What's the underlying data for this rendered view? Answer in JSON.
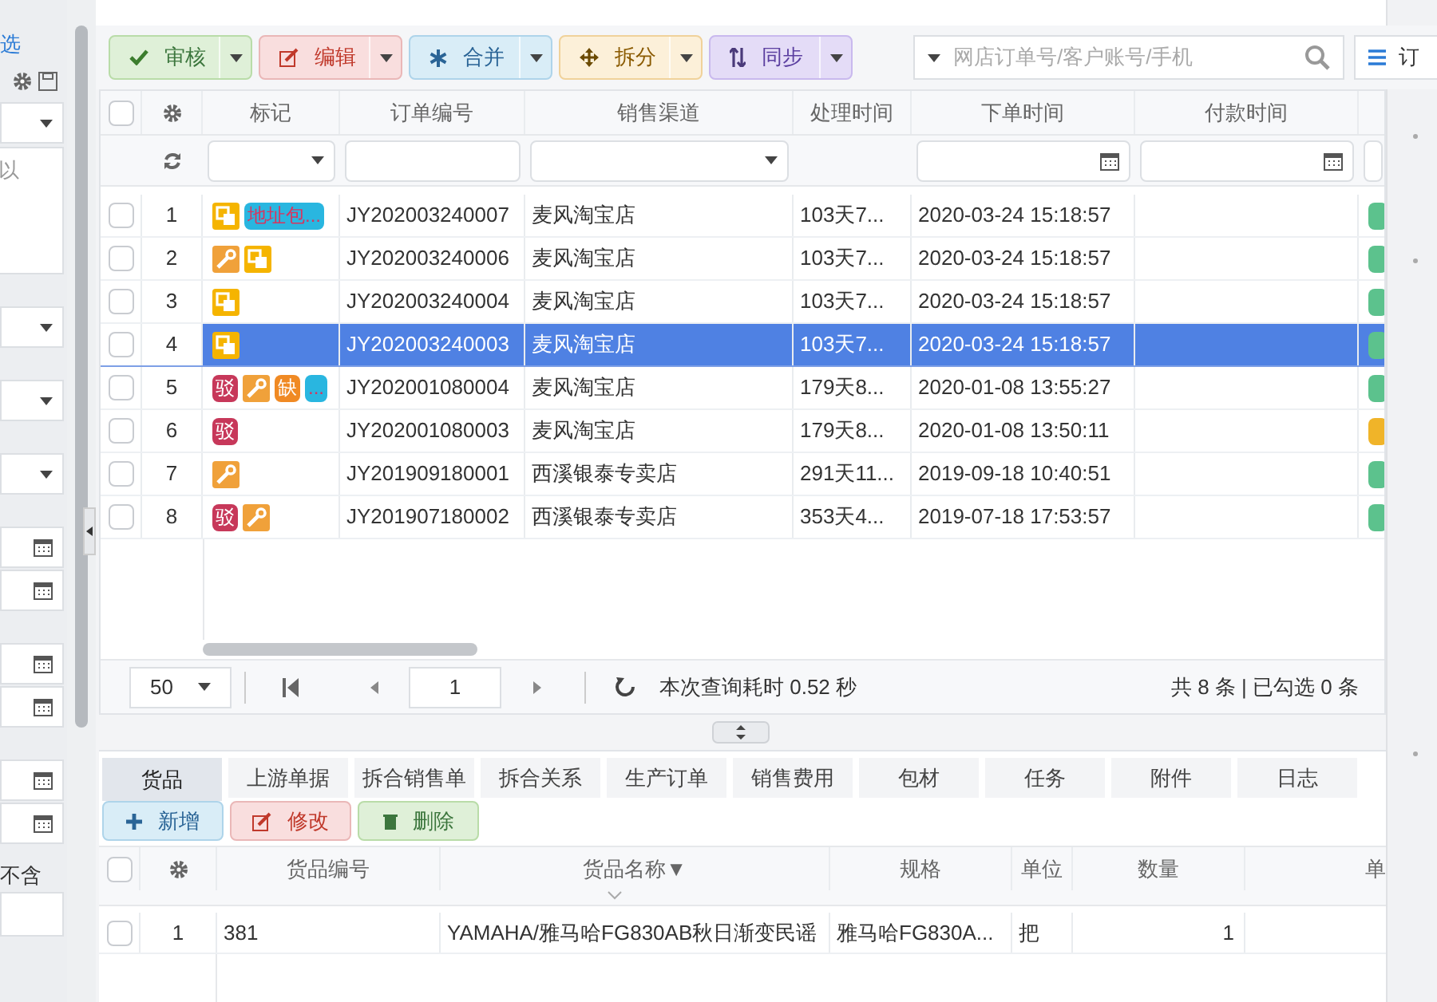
{
  "sidebar": {
    "link": "选",
    "hint_text": "以",
    "label": "不含"
  },
  "toolbar": [
    {
      "label": "审核"
    },
    {
      "label": "编辑"
    },
    {
      "label": "合并"
    },
    {
      "label": "拆分"
    },
    {
      "label": "同步"
    }
  ],
  "search": {
    "placeholder": "网店订单号/客户账号/手机"
  },
  "menu_button": {
    "label": "订"
  },
  "orders": {
    "select_all": {
      "checked": false
    },
    "columns": [
      "标记",
      "订单编号",
      "销售渠道",
      "处理时间",
      "下单时间",
      "付款时间"
    ],
    "rows": [
      {
        "index": "1",
        "checked": false,
        "selected": false,
        "marks": [
          {
            "kind": "split"
          },
          {
            "kind": "tag",
            "text": "地址包...",
            "color": "#29b6e0"
          }
        ],
        "order_no": "JY202003240007",
        "channel": "麦风淘宝店",
        "elapsed": "103天7...",
        "order_time": "2020-03-24 15:18:57",
        "status_tag": {
          "color": "#5cc28d"
        }
      },
      {
        "index": "2",
        "checked": false,
        "selected": false,
        "marks": [
          {
            "kind": "wrench"
          },
          {
            "kind": "split"
          }
        ],
        "order_no": "JY202003240006",
        "channel": "麦风淘宝店",
        "elapsed": "103天7...",
        "order_time": "2020-03-24 15:18:57",
        "status_tag": {
          "color": "#5cc28d"
        }
      },
      {
        "index": "3",
        "checked": false,
        "selected": false,
        "marks": [
          {
            "kind": "split"
          }
        ],
        "order_no": "JY202003240004",
        "channel": "麦风淘宝店",
        "elapsed": "103天7...",
        "order_time": "2020-03-24 15:18:57",
        "status_tag": {
          "color": "#5cc28d"
        }
      },
      {
        "index": "4",
        "checked": false,
        "selected": true,
        "marks": [
          {
            "kind": "split"
          }
        ],
        "order_no": "JY202003240003",
        "channel": "麦风淘宝店",
        "elapsed": "103天7...",
        "order_time": "2020-03-24 15:18:57",
        "status_tag": {
          "color": "#5cc28d"
        }
      },
      {
        "index": "5",
        "checked": false,
        "selected": false,
        "marks": [
          {
            "kind": "tag",
            "text": "驳",
            "color": "#c7385a"
          },
          {
            "kind": "wrench"
          },
          {
            "kind": "tag",
            "text": "缺",
            "color": "#f08a24"
          },
          {
            "kind": "tag",
            "text": "...",
            "color": "#29b6e0"
          }
        ],
        "order_no": "JY202001080004",
        "channel": "麦风淘宝店",
        "elapsed": "179天8...",
        "order_time": "2020-01-08 13:55:27",
        "status_tag": {
          "color": "#5cc28d"
        }
      },
      {
        "index": "6",
        "checked": false,
        "selected": false,
        "marks": [
          {
            "kind": "tag",
            "text": "驳",
            "color": "#c7385a"
          }
        ],
        "order_no": "JY202001080003",
        "channel": "麦风淘宝店",
        "elapsed": "179天8...",
        "order_time": "2020-01-08 13:50:11",
        "status_tag": {
          "color": "#f0b429"
        }
      },
      {
        "index": "7",
        "checked": false,
        "selected": false,
        "marks": [
          {
            "kind": "wrench"
          }
        ],
        "order_no": "JY201909180001",
        "channel": "西溪银泰专卖店",
        "elapsed": "291天11...",
        "order_time": "2019-09-18 10:40:51",
        "status_tag": {
          "color": "#5cc28d"
        }
      },
      {
        "index": "8",
        "checked": false,
        "selected": false,
        "marks": [
          {
            "kind": "tag",
            "text": "驳",
            "color": "#c7385a"
          },
          {
            "kind": "wrench"
          }
        ],
        "order_no": "JY201907180002",
        "channel": "西溪银泰专卖店",
        "elapsed": "353天4...",
        "order_time": "2019-07-18 17:53:57",
        "status_tag": {
          "color": "#5cc28d"
        }
      }
    ]
  },
  "pager": {
    "page_size": "50",
    "page": "1",
    "query_time": "本次查询耗时 0.52 秒",
    "summary": "共 8 条 | 已勾选 0 条"
  },
  "detail_tabs": [
    {
      "label": "货品",
      "selected": true
    },
    {
      "label": "上游单据",
      "selected": false
    },
    {
      "label": "拆合销售单",
      "selected": false
    },
    {
      "label": "拆合关系",
      "selected": false
    },
    {
      "label": "生产订单",
      "selected": false
    },
    {
      "label": "销售费用",
      "selected": false
    },
    {
      "label": "包材",
      "selected": false
    },
    {
      "label": "任务",
      "selected": false
    },
    {
      "label": "附件",
      "selected": false
    },
    {
      "label": "日志",
      "selected": false
    }
  ],
  "detail_actions": [
    {
      "label": "新增"
    },
    {
      "label": "修改"
    },
    {
      "label": "删除"
    }
  ],
  "items": {
    "select_all": {
      "checked": false
    },
    "columns": [
      "货品编号",
      "货品名称▼",
      "规格",
      "单位",
      "数量",
      "单"
    ],
    "rows": [
      {
        "index": "1",
        "checked": false,
        "code": "381",
        "name": "YAMAHA/雅马哈FG830AB秋日渐变民谣",
        "spec": "雅马哈FG830A...",
        "unit": "把",
        "qty": "1"
      }
    ]
  }
}
